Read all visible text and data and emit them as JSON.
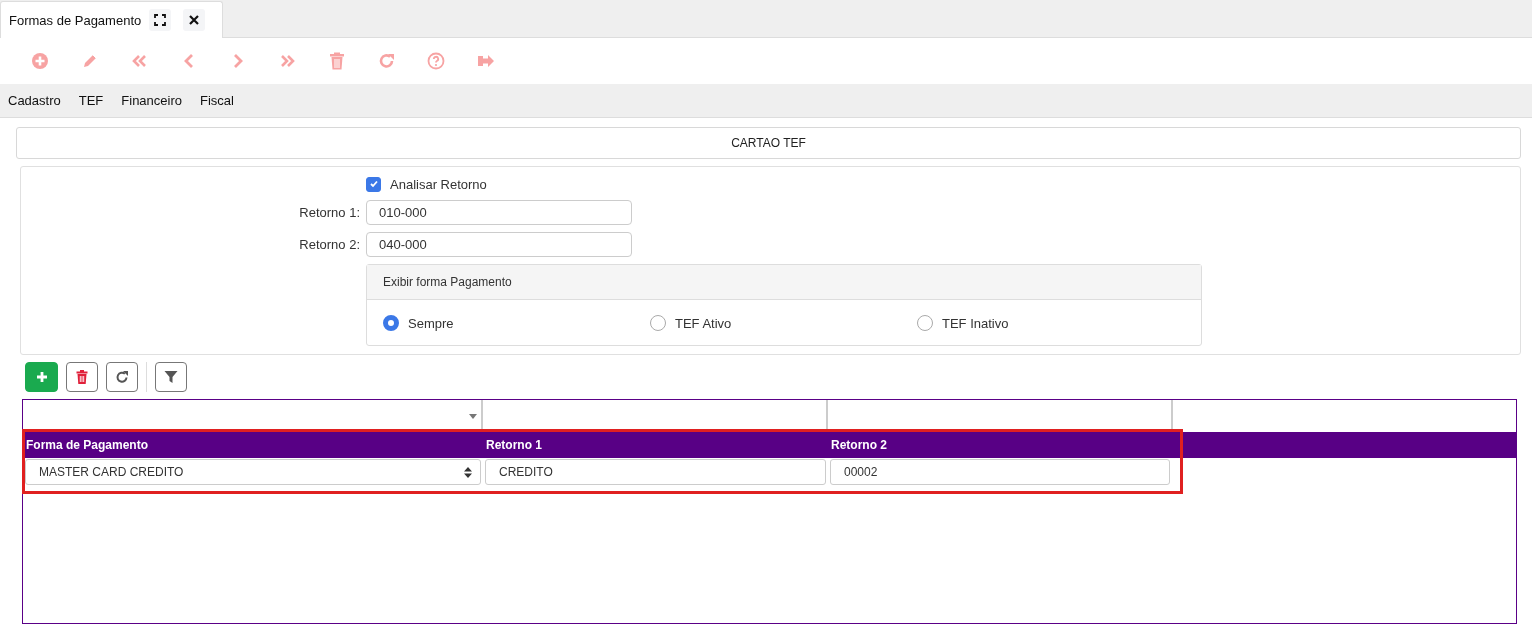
{
  "tab": {
    "title": "Formas de Pagamento",
    "selected": true
  },
  "menu": [
    "Cadastro",
    "TEF",
    "Financeiro",
    "Fiscal"
  ],
  "section_title": "CARTAO TEF",
  "analisar": {
    "label": "Analisar Retorno",
    "checked": true
  },
  "fields": [
    {
      "label": "Retorno 1:",
      "value": "010-000"
    },
    {
      "label": "Retorno 2:",
      "value": "040-000"
    }
  ],
  "fieldset": {
    "legend": "Exibir forma Pagamento",
    "options": [
      {
        "label": "Sempre",
        "selected": true
      },
      {
        "label": "TEF Ativo",
        "selected": false
      },
      {
        "label": "TEF Inativo",
        "selected": false
      }
    ]
  },
  "grid": {
    "highlighted": true,
    "columns": [
      {
        "title": "Forma de Pagamento",
        "kind": "select"
      },
      {
        "title": "Retorno 1",
        "kind": "text"
      },
      {
        "title": "Retorno 2",
        "kind": "text"
      }
    ],
    "rows": [
      {
        "cells": [
          "MASTER CARD CREDITO",
          "CREDITO",
          "00002"
        ]
      }
    ]
  }
}
